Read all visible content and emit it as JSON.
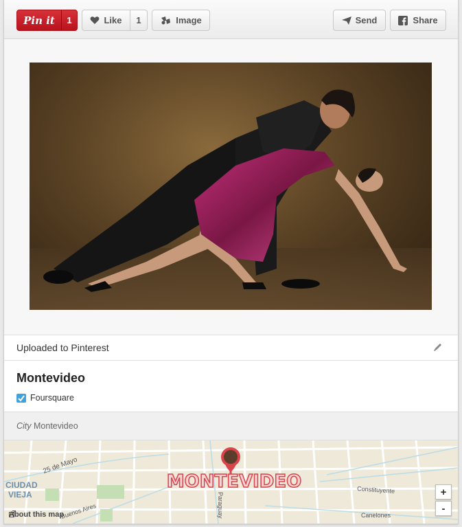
{
  "toolbar": {
    "pin_label": "Pin it",
    "pin_count": "1",
    "like_label": "Like",
    "like_count": "1",
    "image_label": "Image",
    "send_label": "Send",
    "share_label": "Share"
  },
  "upload": {
    "text": "Uploaded to Pinterest"
  },
  "place": {
    "title": "Montevideo",
    "source": "Foursquare"
  },
  "city": {
    "label": "City",
    "value": "Montevideo"
  },
  "map": {
    "marker_label": "MONTEVIDEO",
    "street_labels": [
      "25 de Mayo",
      "CIUDAD",
      "VIEJA",
      "Paraguay",
      "Constituyente",
      "Canelones",
      "Buenos Aires"
    ],
    "about_label": "About this map",
    "zoom_in": "+",
    "zoom_out": "-"
  },
  "colors": {
    "pin_red": "#c8202a",
    "map_bg": "#efe9d9",
    "marker_red": "#d9434a"
  }
}
